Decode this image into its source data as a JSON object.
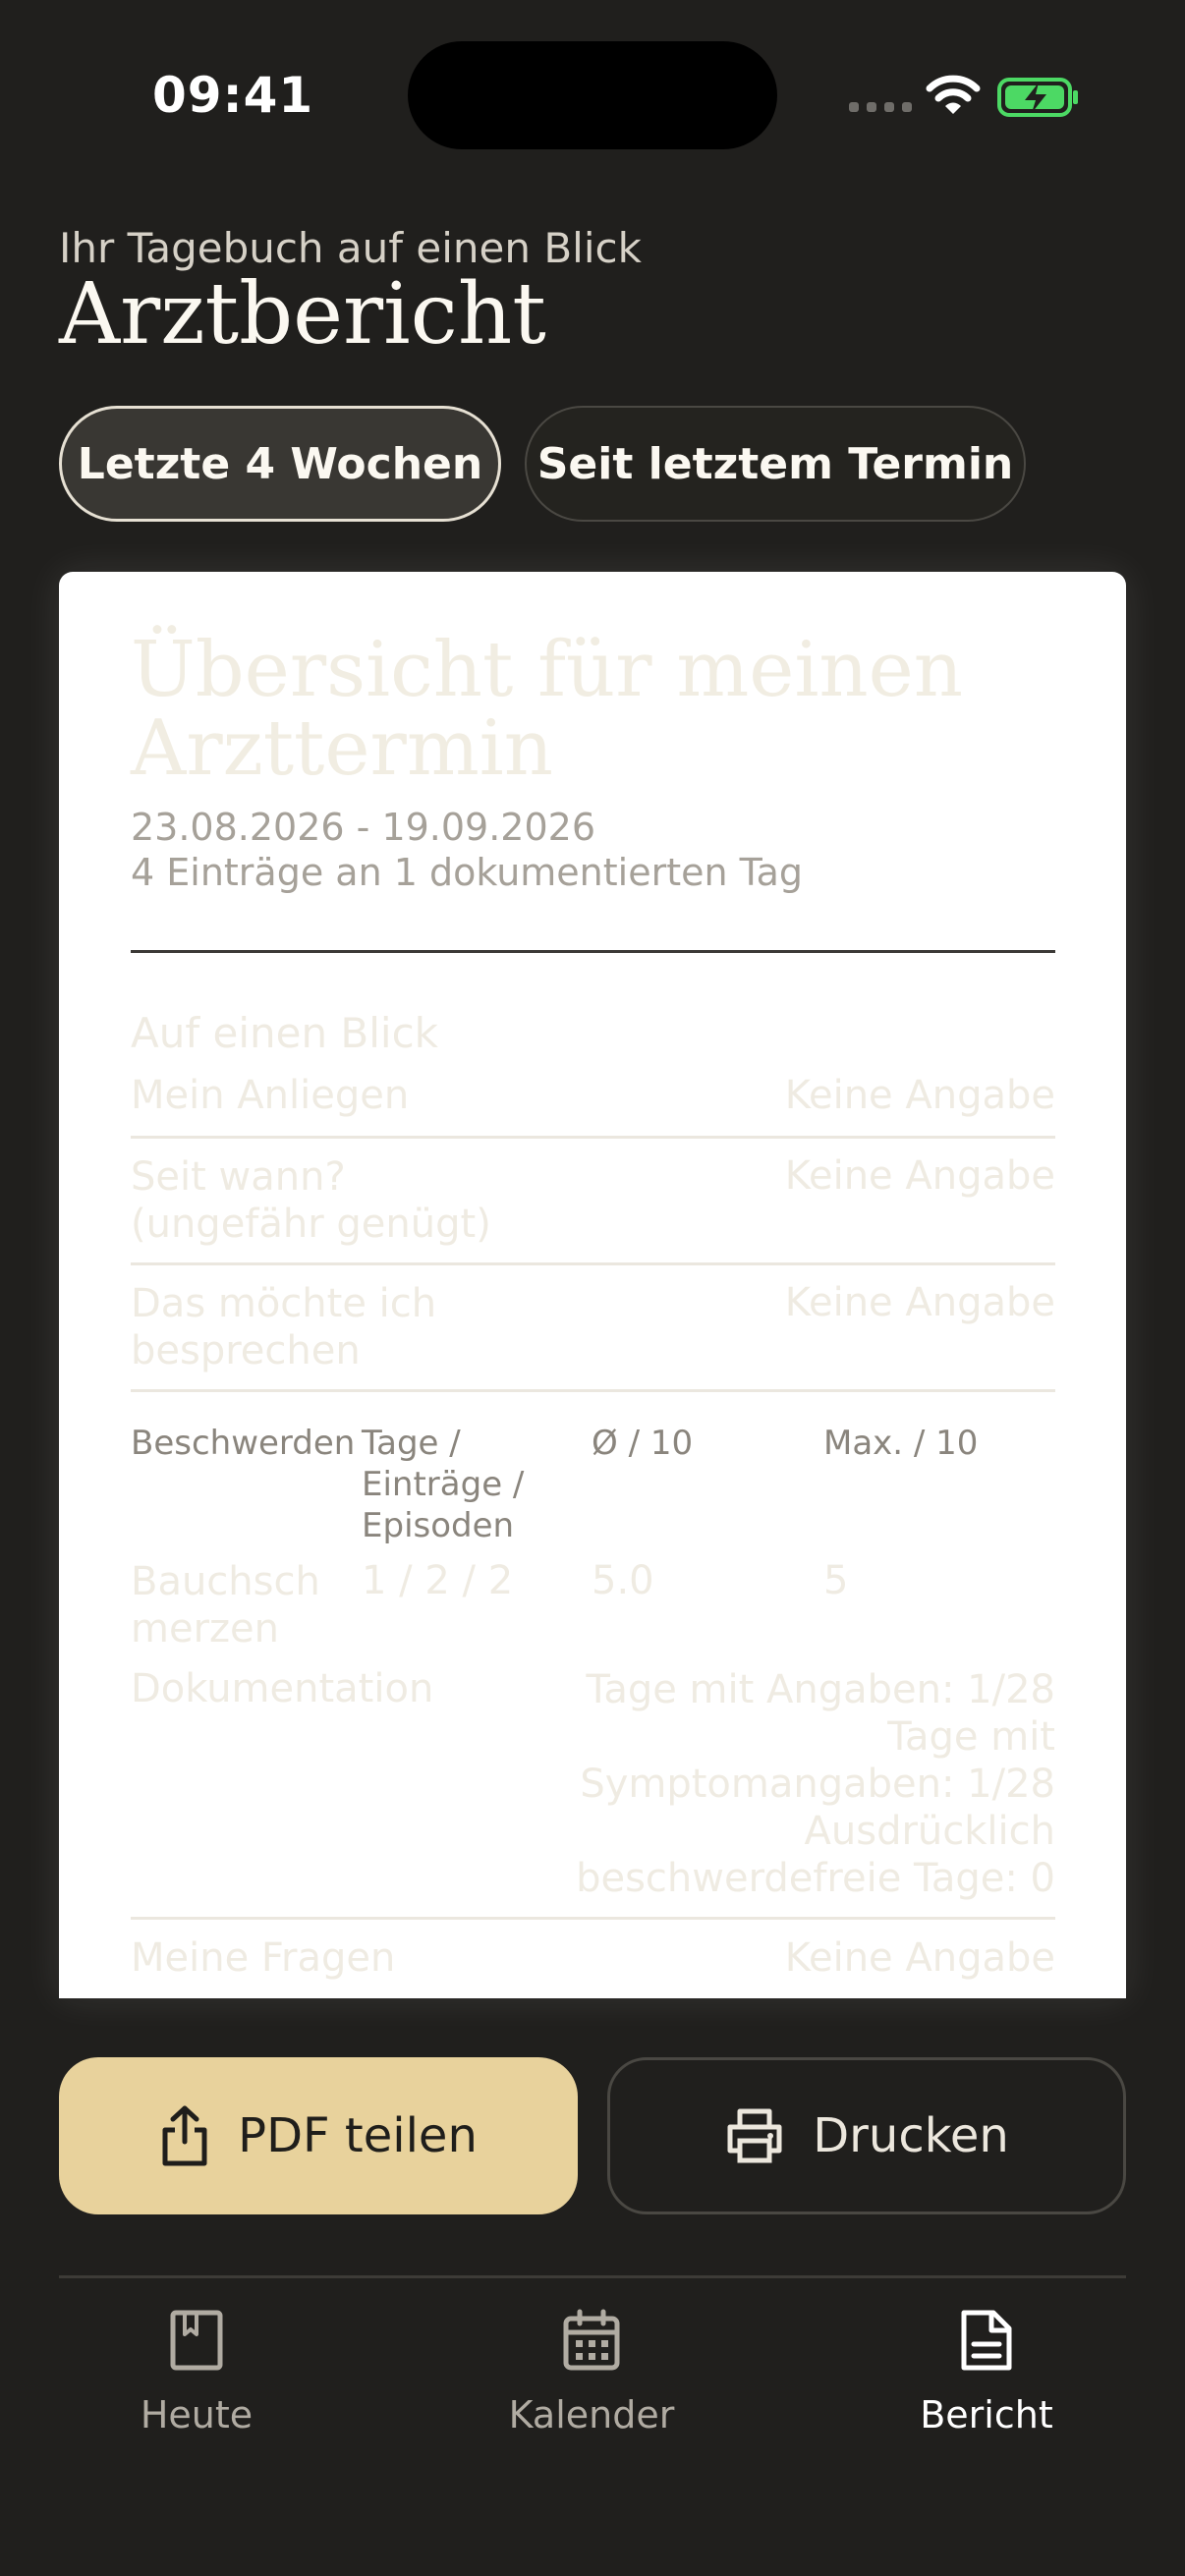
{
  "status_bar": {
    "time": "09:41"
  },
  "header": {
    "subtitle": "Ihr Tagebuch auf einen Blick",
    "title": "Arztbericht"
  },
  "range_tabs": [
    {
      "label": "Letzte 4 Wochen",
      "selected": true
    },
    {
      "label": "Seit letztem Termin",
      "selected": false
    }
  ],
  "report": {
    "title": "Übersicht für meinen Arzttermin",
    "date_range": "23.08.2026 - 19.09.2026",
    "entries_summary": "4 Einträge an 1 dokumentierten Tag",
    "overview": {
      "heading": "Auf einen Blick",
      "rows": [
        {
          "label": "Mein Anliegen",
          "value": "Keine Angabe"
        },
        {
          "label": "Seit wann? (ungefähr genügt)",
          "value": "Keine Angabe"
        },
        {
          "label": "Das möchte ich besprechen",
          "value": "Keine Angabe"
        }
      ]
    },
    "complaints_table": {
      "headers": [
        "Beschwerden",
        "Tage / Einträge / Episoden",
        "Ø / 10",
        "Max. / 10"
      ],
      "rows": [
        [
          "Bauchschmerzen",
          "1 / 2 / 2",
          "5.0",
          "5"
        ]
      ]
    },
    "documentation": {
      "label": "Dokumentation",
      "lines": [
        "Tage mit Angaben: 1/28",
        "Tage mit Symptomangaben: 1/28",
        "Ausdrücklich beschwerdefreie Tage: 0"
      ]
    },
    "questions": {
      "label": "Meine Fragen",
      "value": "Keine Angabe"
    }
  },
  "actions": {
    "share_label": "PDF teilen",
    "print_label": "Drucken"
  },
  "tab_bar": [
    {
      "label": "Heute",
      "icon": "book-icon",
      "active": false
    },
    {
      "label": "Kalender",
      "icon": "calendar-icon",
      "active": false
    },
    {
      "label": "Bericht",
      "icon": "document-icon",
      "active": true
    }
  ],
  "colors": {
    "background": "#201f1d",
    "accent": "#e8d29c",
    "card": "#ffffff",
    "battery_green": "#4cd964"
  }
}
